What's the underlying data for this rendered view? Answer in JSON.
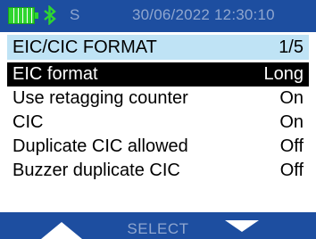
{
  "status": {
    "letter": "S",
    "datetime": "30/06/2022  12:30:10",
    "battery_level": 1.0,
    "colors": {
      "bar": "#1d4ea0",
      "text": "#8fa6cf",
      "battery": "#2fd62f",
      "bluetooth": "#2fd62f"
    }
  },
  "header": {
    "title": "EIC/CIC FORMAT",
    "page": "1/5",
    "color": "#bfe3f5"
  },
  "menu": {
    "items": [
      {
        "label": "EIC format",
        "value": "Long",
        "selected": true
      },
      {
        "label": "Use retagging counter",
        "value": "On",
        "selected": false
      },
      {
        "label": "CIC",
        "value": "On",
        "selected": false
      },
      {
        "label": "Duplicate CIC allowed",
        "value": "Off",
        "selected": false
      },
      {
        "label": "Buzzer duplicate CIC",
        "value": "Off",
        "selected": false
      }
    ]
  },
  "softkeys": {
    "left_icon": "arrow-up-icon",
    "center_label": "SELECT",
    "right_icon": "arrow-down-icon"
  }
}
